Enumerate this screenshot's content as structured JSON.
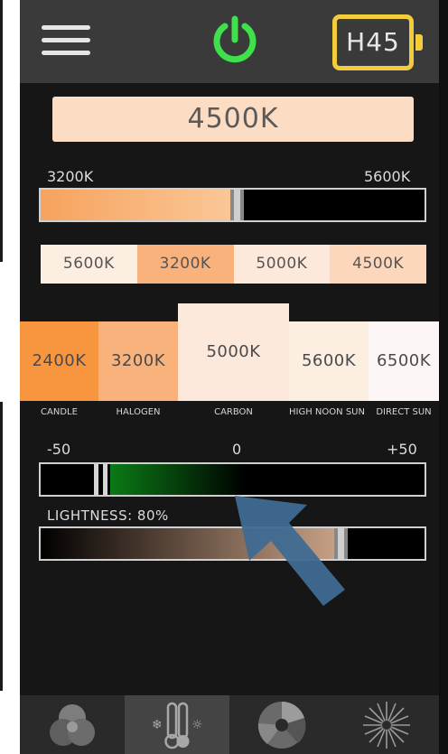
{
  "header": {
    "menu_icon": "hamburger-menu-icon",
    "power_icon": "power-icon",
    "power_color": "#3fe04b",
    "battery_label": "H45",
    "battery_color": "#f2cc3a"
  },
  "current_temp": "4500K",
  "temp_slider": {
    "min_label": "3200K",
    "max_label": "5600K",
    "value_fraction": 0.53,
    "fill_color": "#f6a35e"
  },
  "presets": [
    {
      "label": "5600K",
      "color": "#fdeee2"
    },
    {
      "label": "3200K",
      "color": "#f9b27c"
    },
    {
      "label": "5000K",
      "color": "#fde9dc"
    },
    {
      "label": "4500K",
      "color": "#fcd7bb"
    }
  ],
  "cards": [
    {
      "label": "2400K",
      "caption": "CANDLE",
      "color": "#f8953f"
    },
    {
      "label": "3200K",
      "caption": "HALOGEN",
      "color": "#f9b27c"
    },
    {
      "label": "5000K",
      "caption": "CARBON",
      "color": "#fde9dc"
    },
    {
      "label": "5600K",
      "caption": "HIGH NOON SUN",
      "color": "#fdeee2"
    },
    {
      "label": "6500K",
      "caption": "DIRECT SUN",
      "color": "#fdf6f6"
    }
  ],
  "green_slider": {
    "min_label": "-50",
    "mid_label": "0",
    "max_label": "+50",
    "value": -34,
    "fill_color": "#0b7a16"
  },
  "lightness": {
    "label": "LIGHTNESS: 80%",
    "value_fraction": 0.8
  },
  "nav": [
    {
      "icon": "color-mix-icon"
    },
    {
      "icon": "temperature-icon"
    },
    {
      "icon": "color-wheel-icon"
    },
    {
      "icon": "effects-burst-icon"
    }
  ],
  "arrow_color": "#3f6a92"
}
